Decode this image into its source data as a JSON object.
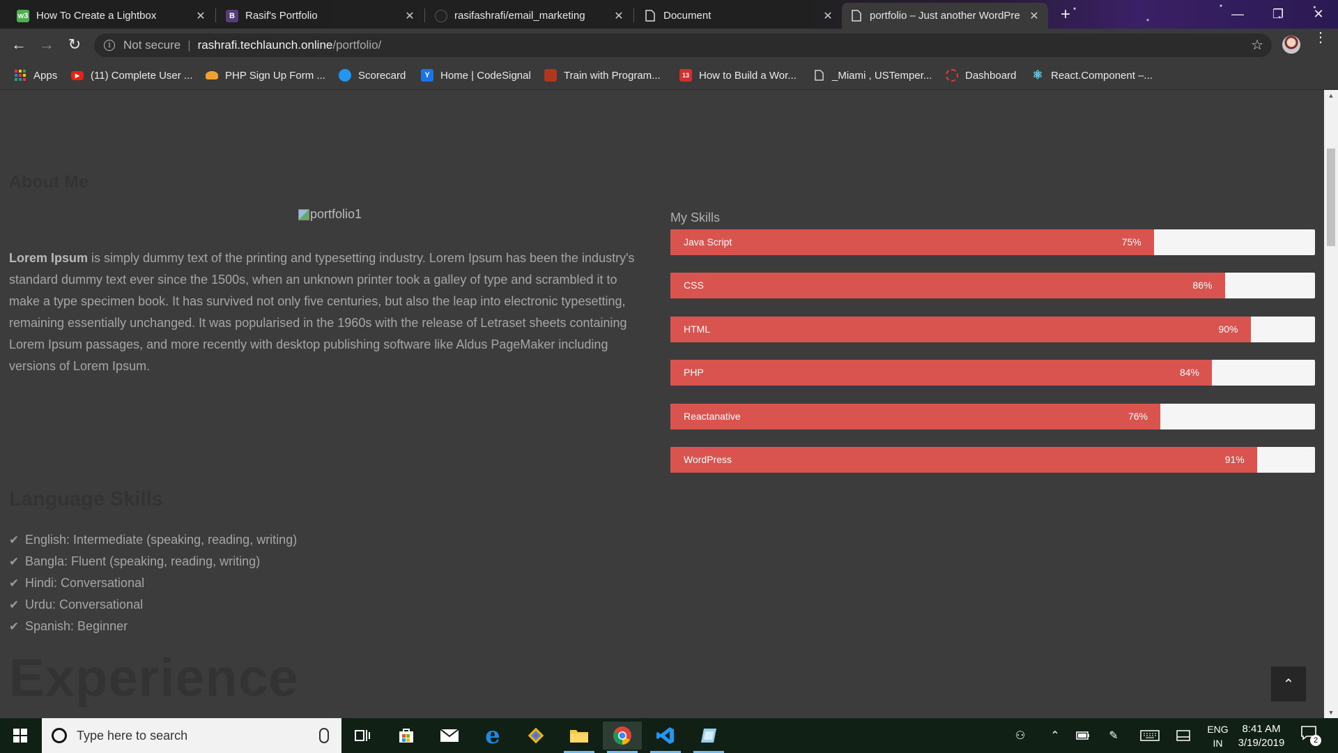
{
  "browser": {
    "tabs": [
      {
        "title": "How To Create a Lightbox",
        "favicon": "w3schools-icon",
        "favicon_text": "w3",
        "favicon_color": "#4caf50",
        "active": false
      },
      {
        "title": "Rasif's Portfolio",
        "favicon": "bootstrap-icon",
        "favicon_text": "B",
        "favicon_color": "#563d7c",
        "active": false
      },
      {
        "title": "rasifashrafi/email_marketing",
        "favicon": "github-icon",
        "favicon_text": "",
        "favicon_color": "#222222",
        "active": false
      },
      {
        "title": "Document",
        "favicon": "document-icon",
        "favicon_text": "",
        "favicon_color": "transparent",
        "active": false
      },
      {
        "title": "portfolio – Just another WordPre",
        "favicon": "document-icon",
        "favicon_text": "",
        "favicon_color": "transparent",
        "active": true
      }
    ],
    "new_tab_label": "+",
    "window_controls": {
      "minimize": "—",
      "restore": "❐",
      "close": "✕"
    },
    "address": {
      "security": "Not secure",
      "host": "rashrafi.techlaunch.online",
      "path": "/portfolio/"
    },
    "bookmarks": [
      {
        "label": "Apps",
        "icon": "apps-grid-icon",
        "color": "#e53935",
        "text": ""
      },
      {
        "label": "(11) Complete User ...",
        "icon": "youtube-icon",
        "color": "#e62117",
        "text": "▶"
      },
      {
        "label": "PHP Sign Up Form ...",
        "icon": "php-icon",
        "color": "#f0a030",
        "text": ""
      },
      {
        "label": "Scorecard",
        "icon": "scorecard-icon",
        "color": "#2196f3",
        "text": ""
      },
      {
        "label": "Home | CodeSignal",
        "icon": "codesignal-icon",
        "color": "#1a73e8",
        "text": "Y"
      },
      {
        "label": "Train with Program...",
        "icon": "codewars-icon",
        "color": "#b1361e",
        "text": ""
      },
      {
        "label": "How to Build a Wor...",
        "icon": "calendar-icon",
        "color": "#d32f2f",
        "text": "13"
      },
      {
        "label": "_Miami , USTemper...",
        "icon": "document-icon",
        "color": "transparent",
        "text": ""
      },
      {
        "label": "Dashboard",
        "icon": "dashboard-icon",
        "color": "#c62828",
        "text": ""
      },
      {
        "label": "React.Component –...",
        "icon": "react-icon",
        "color": "transparent",
        "text": "⚛"
      }
    ]
  },
  "page": {
    "about_title": "About Me",
    "image_alt": "portfolio1",
    "lorem_bold": "Lorem Ipsum",
    "lorem_text": " is simply dummy text of the printing and typesetting industry. Lorem Ipsum has been the industry's standard dummy text ever since the 1500s, when an unknown printer took a galley of type and scrambled it to make a type specimen book. It has survived not only five centuries, but also the leap into electronic typesetting, remaining essentially unchanged. It was popularised in the 1960s with the release of Letraset sheets containing Lorem Ipsum passages, and more recently with desktop publishing software like Aldus PageMaker including versions of Lorem Ipsum.",
    "skills_title": "My Skills",
    "skills": [
      {
        "name": "Java Script",
        "percent": 75,
        "label": "75%"
      },
      {
        "name": "CSS",
        "percent": 86,
        "label": "86%"
      },
      {
        "name": "HTML",
        "percent": 90,
        "label": "90%"
      },
      {
        "name": "PHP",
        "percent": 84,
        "label": "84%"
      },
      {
        "name": "Reactanative",
        "percent": 76,
        "label": "76%"
      },
      {
        "name": "WordPress",
        "percent": 91,
        "label": "91%"
      }
    ],
    "skill_color": "#d9534f",
    "language_title": "Language Skills",
    "languages": [
      "English: Intermediate (speaking, reading, writing)",
      "Bangla: Fluent (speaking, reading, writing)",
      "Hindi: Conversational",
      "Urdu: Conversational",
      "Spanish: Beginner"
    ],
    "experience_title": "Experience",
    "back_to_top": "⌃"
  },
  "taskbar": {
    "search_placeholder": "Type here to search",
    "apps": [
      "task-view-icon",
      "store-icon",
      "mail-icon",
      "edge-icon",
      "git-icon",
      "file-explorer-icon",
      "chrome-icon",
      "vscode-icon",
      "app-icon"
    ],
    "language_top": "ENG",
    "language_bottom": "IN",
    "time": "8:41 AM",
    "date": "3/19/2019",
    "notification_count": "2"
  }
}
